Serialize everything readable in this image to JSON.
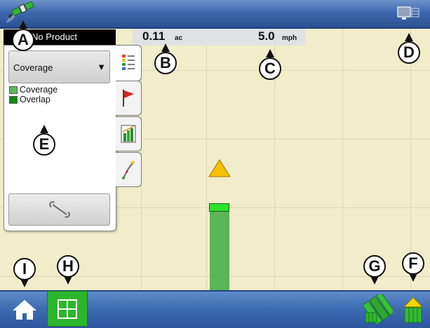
{
  "product_label": "No Product",
  "stats": {
    "area_value": "0.11",
    "area_unit": "ac",
    "speed_value": "5.0",
    "speed_unit": "mph"
  },
  "map_panel": {
    "dropdown_value": "Coverage",
    "legend": [
      {
        "label": "Coverage",
        "color": "#5cb85a"
      },
      {
        "label": "Overlap",
        "color": "#138a16"
      }
    ]
  },
  "side_tabs": [
    "legend-icon",
    "flag-icon",
    "chart-icon",
    "guidance-icon"
  ],
  "bottom_icons": [
    "home-icon",
    "map-grid-icon",
    "field-operations-icon",
    "yield-icon"
  ],
  "callouts": {
    "a": "A",
    "b": "B",
    "c": "C",
    "d": "D",
    "e": "E",
    "f": "F",
    "g": "G",
    "h": "H",
    "i": "I"
  },
  "colors": {
    "top_bar": "#3d68ae",
    "bottom_bar": "#3e6db3",
    "map_background": "#f1ecca",
    "swath": "#59b555",
    "implement": "#2ce02c",
    "vehicle": "#f5c000",
    "map_button": "#2db52d"
  }
}
